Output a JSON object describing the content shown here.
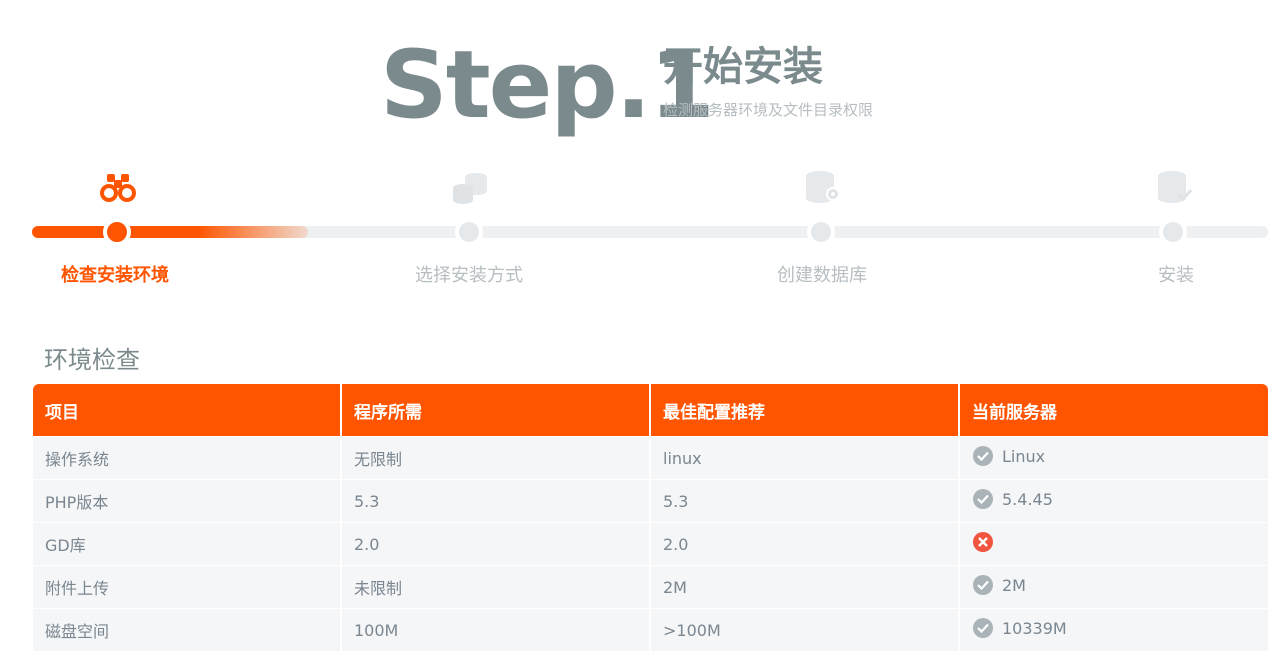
{
  "header": {
    "step_number": "Step.1",
    "title": "开始安装",
    "subtitle": "检测服务器环境及文件目录权限"
  },
  "steps": [
    {
      "label": "检查安装环境",
      "icon": "binoculars-icon",
      "state": "active"
    },
    {
      "label": "选择安装方式",
      "icon": "database-stack-icon",
      "state": "inactive"
    },
    {
      "label": "创建数据库",
      "icon": "database-settings-icon",
      "state": "inactive"
    },
    {
      "label": "安装",
      "icon": "database-check-icon",
      "state": "inactive"
    }
  ],
  "colors": {
    "accent": "#ff5500",
    "ok": "#9aa5ab",
    "error": "#f2553f"
  },
  "section": {
    "title": "环境检查"
  },
  "table": {
    "headers": [
      "项目",
      "程序所需",
      "最佳配置推荐",
      "当前服务器"
    ],
    "rows": [
      {
        "item": "操作系统",
        "required": "无限制",
        "recommended": "linux",
        "current": "Linux",
        "status": "ok"
      },
      {
        "item": "PHP版本",
        "required": "5.3",
        "recommended": "5.3",
        "current": "5.4.45",
        "status": "ok"
      },
      {
        "item": "GD库",
        "required": "2.0",
        "recommended": "2.0",
        "current": "",
        "status": "error"
      },
      {
        "item": "附件上传",
        "required": "未限制",
        "recommended": "2M",
        "current": "2M",
        "status": "ok"
      },
      {
        "item": "磁盘空间",
        "required": "100M",
        "recommended": ">100M",
        "current": "10339M",
        "status": "ok"
      }
    ]
  }
}
